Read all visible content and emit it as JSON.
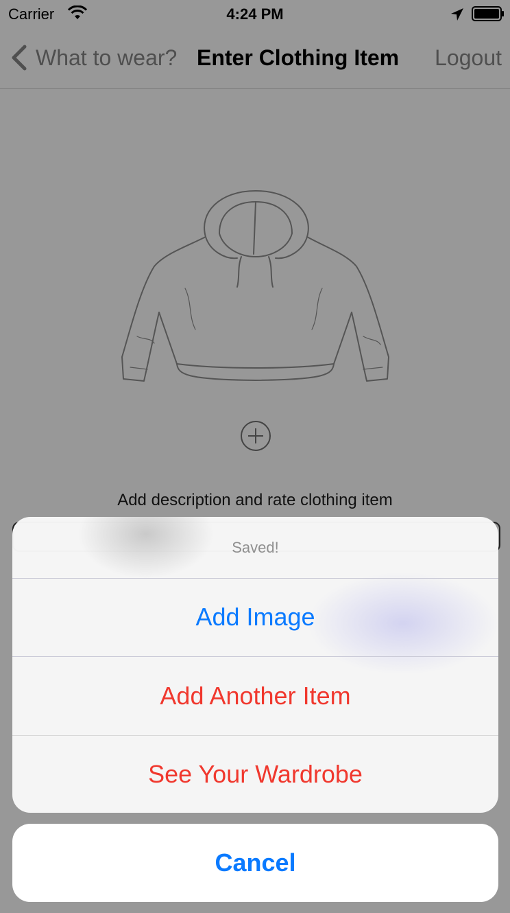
{
  "status_bar": {
    "carrier": "Carrier",
    "time": "4:24 PM",
    "icons": [
      "wifi-icon",
      "location-arrow-icon",
      "battery-icon"
    ]
  },
  "nav": {
    "back_label": "What to wear?",
    "title": "Enter Clothing Item",
    "logout_label": "Logout"
  },
  "content": {
    "image_icon": "hoodie-icon",
    "add_icon": "plus-circle-icon",
    "description_label": "Add description and rate clothing item"
  },
  "action_sheet": {
    "title": "Saved!",
    "buttons": [
      {
        "label": "Add Image",
        "color": "#0a7aff"
      },
      {
        "label": "Add Another Item",
        "color": "#f0382e"
      },
      {
        "label": "See Your Wardrobe",
        "color": "#f0382e"
      }
    ],
    "cancel_label": "Cancel"
  },
  "colors": {
    "dim_background": "#989898",
    "ios_blue": "#0a7aff",
    "destructive_red": "#f0382e"
  }
}
